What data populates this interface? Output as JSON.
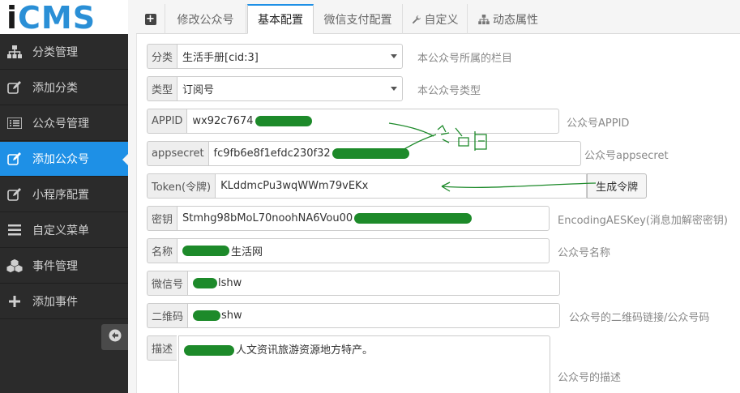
{
  "app": {
    "logo_i": "i",
    "logo_rest": "CMS"
  },
  "sidebar": {
    "items": [
      {
        "label": "分类管理",
        "icon": "sitemap-icon"
      },
      {
        "label": "添加分类",
        "icon": "edit-icon"
      },
      {
        "label": "公众号管理",
        "icon": "list-icon"
      },
      {
        "label": "添加公众号",
        "icon": "edit-icon",
        "active": true
      },
      {
        "label": "小程序配置",
        "icon": "edit-icon"
      },
      {
        "label": "自定义菜单",
        "icon": "bars-icon"
      },
      {
        "label": "事件管理",
        "icon": "cubes-icon"
      },
      {
        "label": "添加事件",
        "icon": "plus-icon"
      }
    ],
    "collapse_icon": "arrow-circle-left-icon"
  },
  "tabs": [
    {
      "label": "+",
      "icon": "plus-square-icon"
    },
    {
      "label": "修改公众号"
    },
    {
      "label": "基本配置",
      "active": true
    },
    {
      "label": "微信支付配置"
    },
    {
      "label": "自定义",
      "icon": "wrench-icon"
    },
    {
      "label": "动态属性",
      "icon": "sitemap-icon"
    }
  ],
  "form": {
    "category": {
      "label": "分类",
      "value": "生活手册[cid:3]",
      "help": "本公众号所属的栏目"
    },
    "type": {
      "label": "类型",
      "value": "订阅号",
      "help": "本公众号类型"
    },
    "appid": {
      "label": "APPID",
      "value": "wx92c7674",
      "help": "公众号APPID"
    },
    "appsecret": {
      "label": "appsecret",
      "value": "fc9fb6e8f1efdc230f32",
      "help": "公众号appsecret"
    },
    "token": {
      "label": "Token(令牌)",
      "value": "KLddmcPu3wqWWm79vEKx",
      "button": "生成令牌"
    },
    "aeskey": {
      "label": "密钥",
      "value": "Stmhg98bMoL70noohNA6Vou00",
      "help": "EncodingAESKey(消息加解密密钥)"
    },
    "name": {
      "label": "名称",
      "value": "生活网",
      "help": "公众号名称"
    },
    "wechat_id": {
      "label": "微信号",
      "value": "lshw"
    },
    "qrcode": {
      "label": "二维码",
      "value": "shw",
      "help": "公众号的二维码链接/公众号码"
    },
    "description": {
      "label": "描述",
      "value": "人文资讯旅游资源地方特产。",
      "help": "公众号的描述"
    }
  },
  "colors": {
    "sidebar_bg": "#2b2b2b",
    "active": "#1e90e6",
    "logo_blue": "#2a8fd6",
    "redaction": "#1d8a2a"
  }
}
